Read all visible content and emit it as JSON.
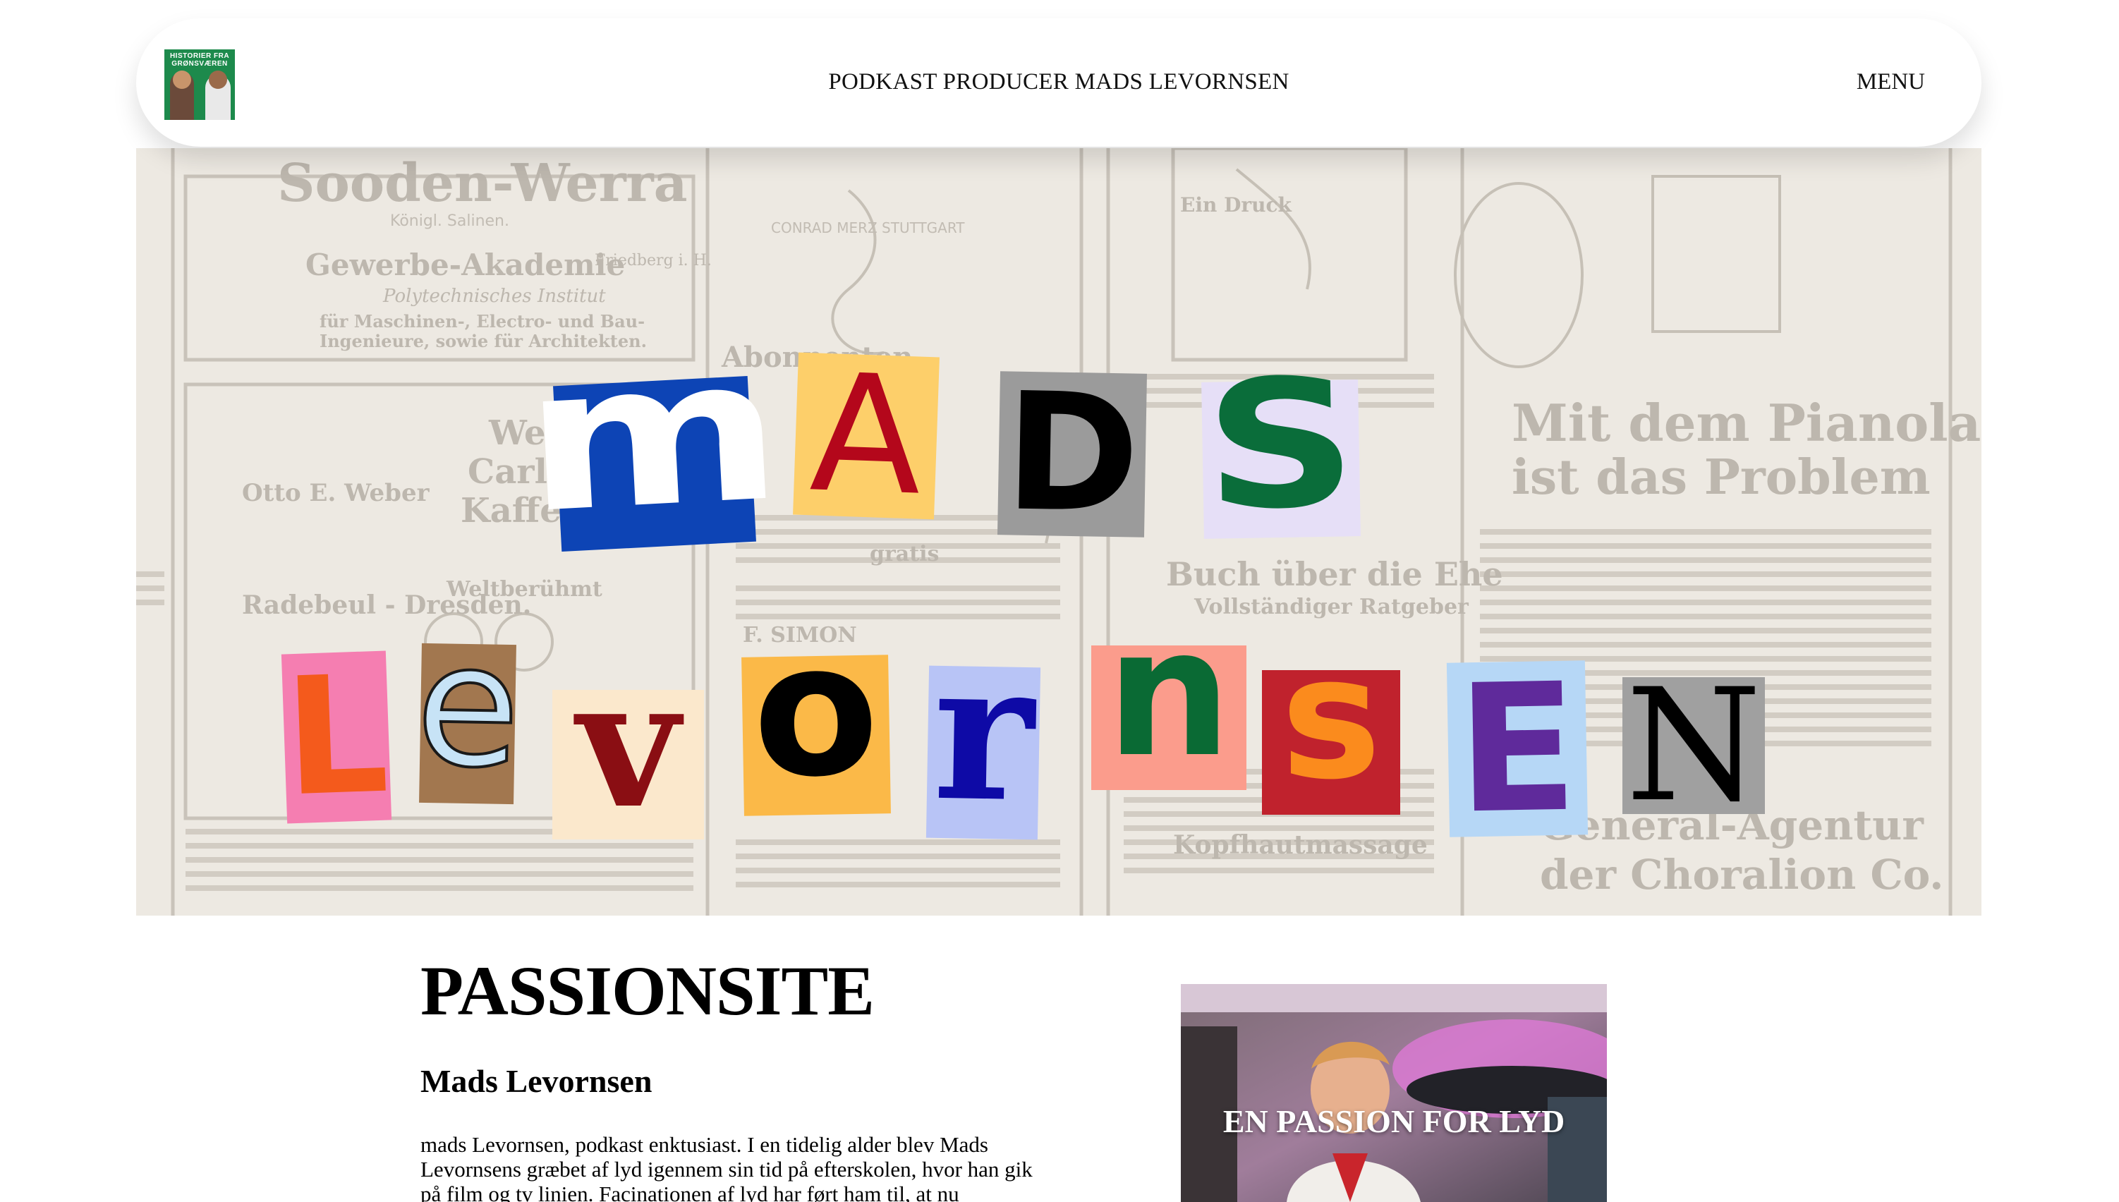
{
  "header": {
    "logo_text": "HISTORIER FRA GRØNSVÆREN",
    "site_title": "PODKAST PRODUCER MADS LEVORNSEN",
    "menu_label": "MENU"
  },
  "hero": {
    "word1": [
      "m",
      "A",
      "D",
      "S"
    ],
    "word2": [
      "L",
      "e",
      "v",
      "o",
      "r",
      "n",
      "s",
      "E",
      "N"
    ],
    "newspaper_snippets": [
      "Sooden-Werra",
      "Königl. Salinen.",
      "Gewerbe-Akademie",
      "Friedberg i. H.",
      "Polytechnisches Institut",
      "für Maschinen-, Electro- und Bau-",
      "Ingenieure, sowie für Architekten.",
      "Abonnenten",
      "Otto E. Weber",
      "Radebeul - Dresden.",
      "Weltberühmt",
      "Weber",
      "Carlsb",
      "Kaffee",
      "Ein Druck",
      "Mit dem Pianola",
      "ist das Problem",
      "Buch über die Ehe",
      "Vollständiger Ratgeber",
      "Kopfhautmassage",
      "General-Agentur",
      "der Choralion Co.",
      "F. SIMON",
      "gratis",
      "CONRAD MERZ STUTTGART"
    ]
  },
  "content": {
    "title": "PASSIONSITE",
    "subtitle": "Mads Levornsen",
    "body": "mads Levornsen, podkast enktusiast. I en tidelig alder blev Mads Levornsens græbet af lyd igennem sin tid på efterskolen, hvor han gik på film og tv linien. Facinationen af lyd har ført ham til, at nu",
    "feature_caption": "EN PASSION FOR LYD"
  },
  "colors": {
    "paper": "#ede9e2",
    "ink": "#bdb7ae"
  }
}
